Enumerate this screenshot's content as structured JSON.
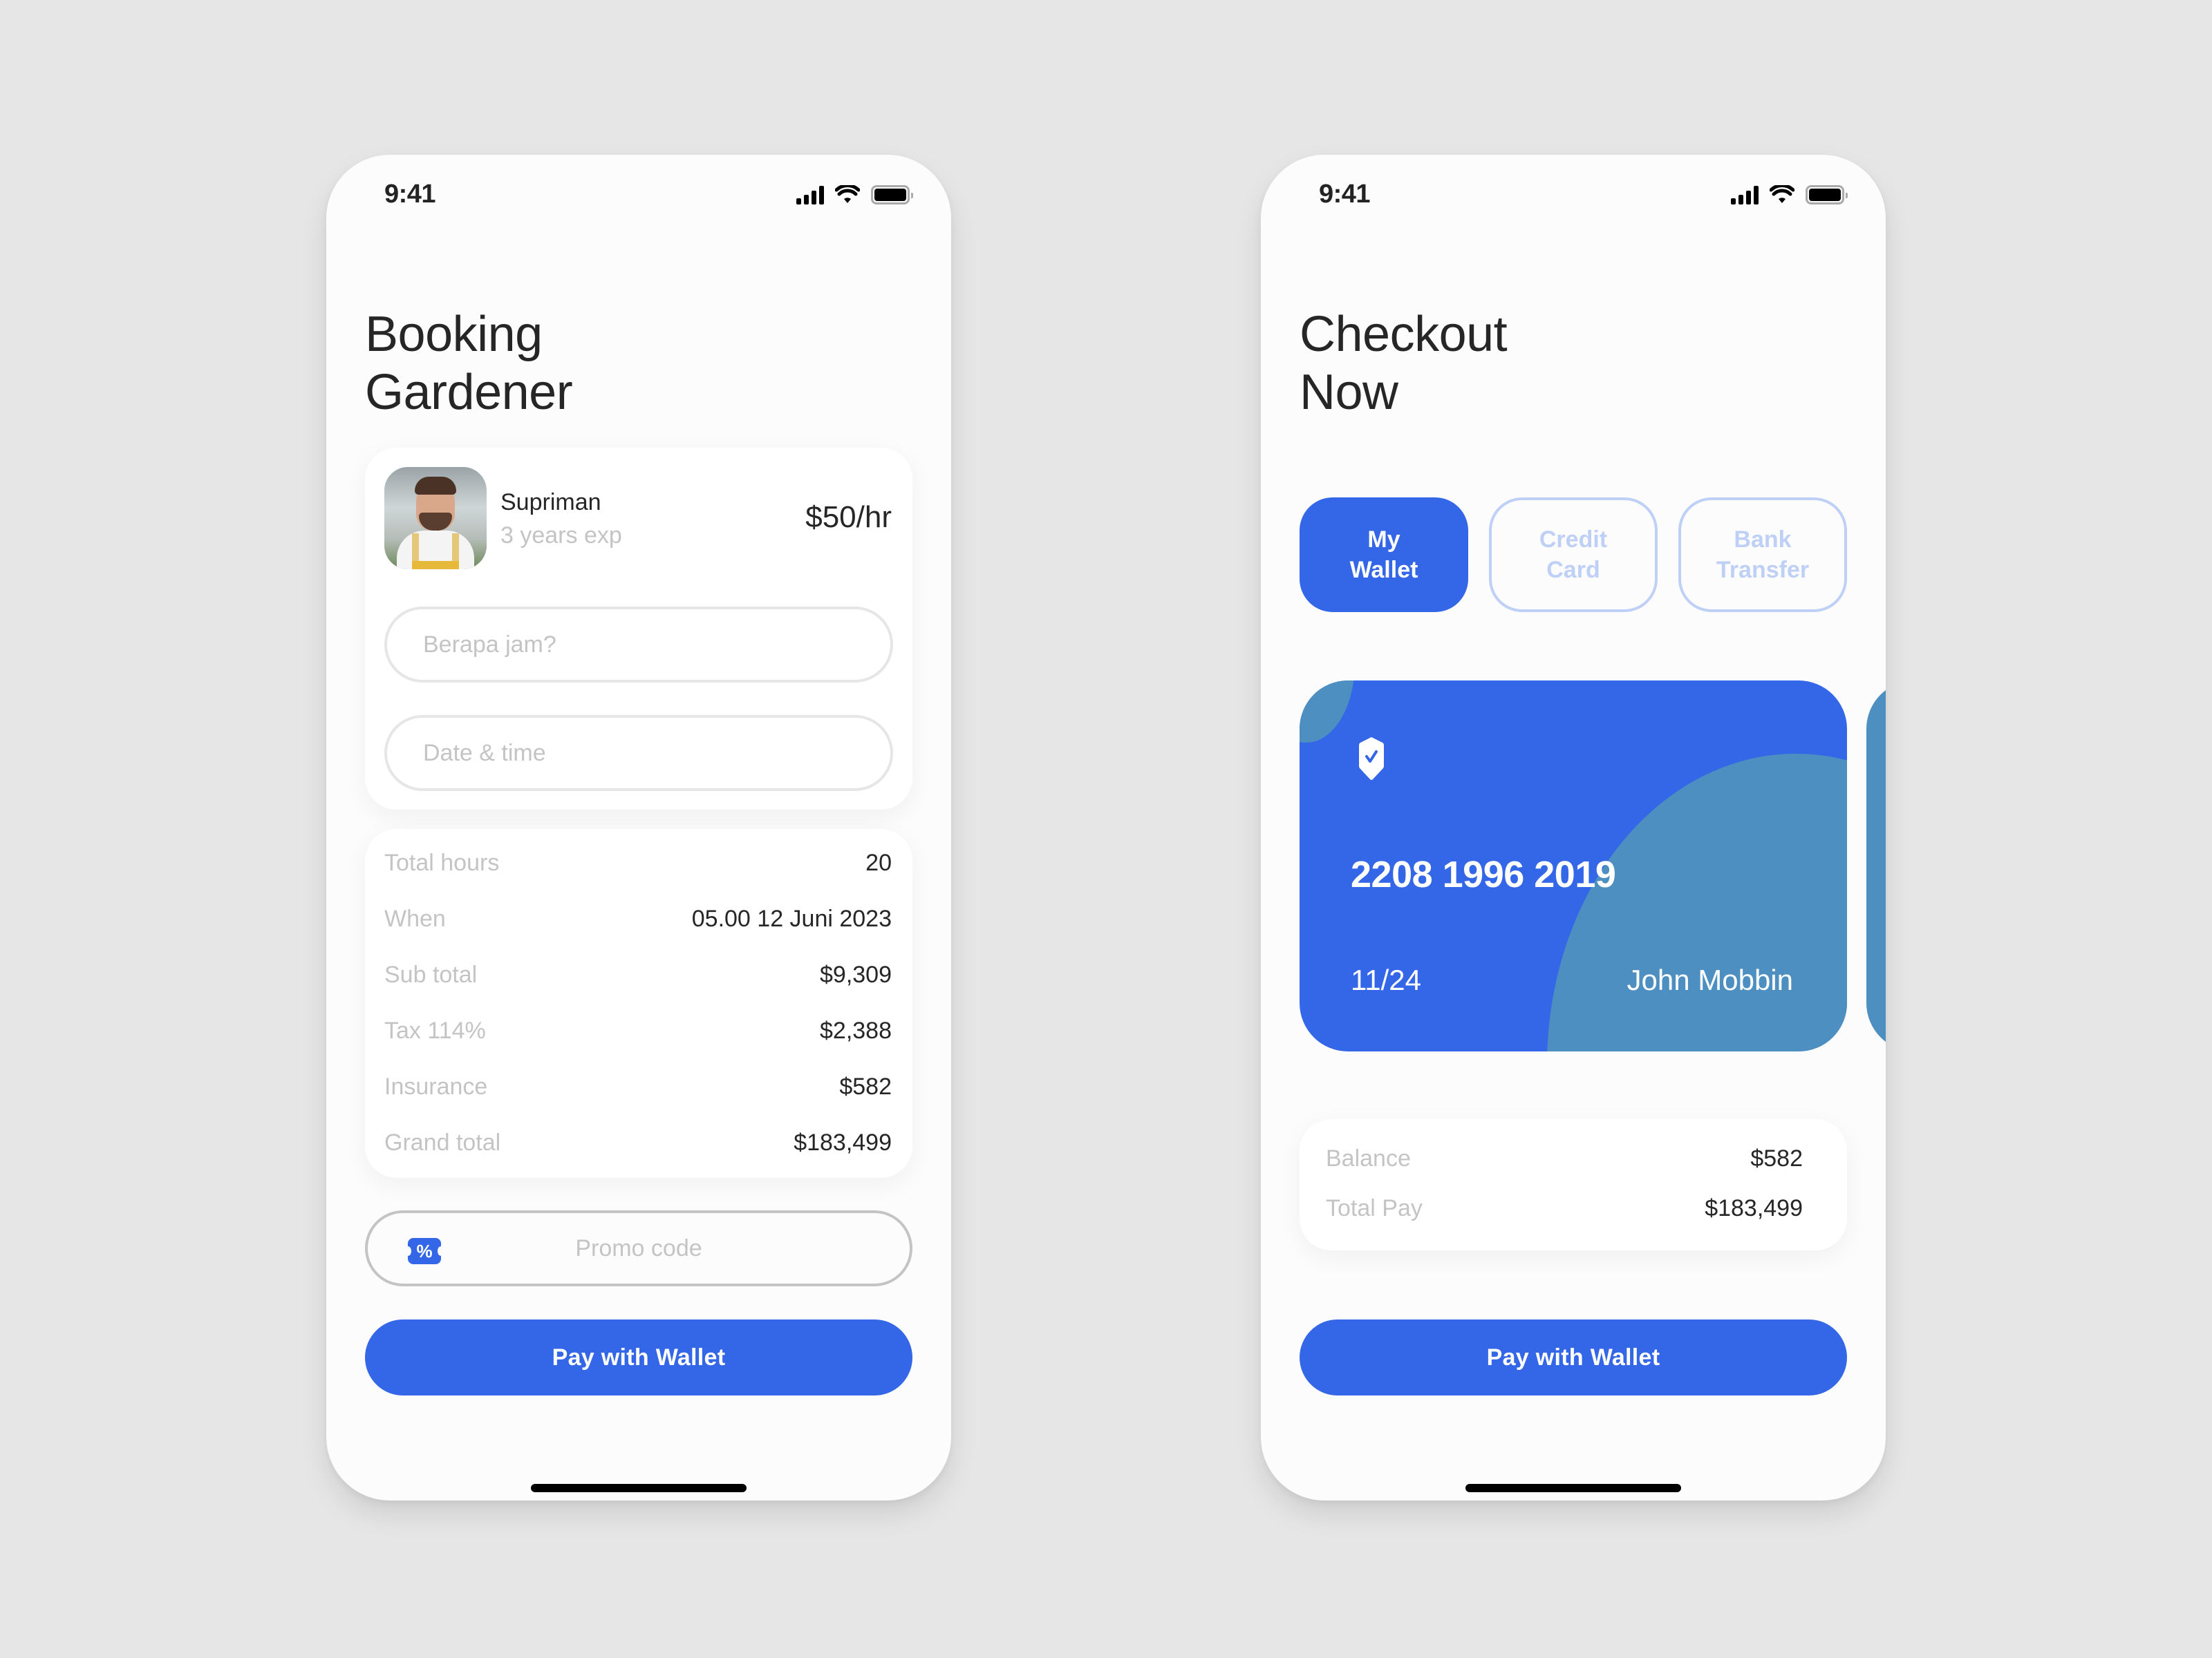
{
  "booking_screen": {
    "status_bar": {
      "time": "9:41",
      "icons": [
        "signal-icon",
        "wifi-icon",
        "battery-icon"
      ]
    },
    "title_line1": "Booking",
    "title_line2": "Gardener",
    "gardener": {
      "name": "Supriman",
      "experience": "3 years exp",
      "rate": "$50/hr",
      "avatar": "gardener-photo"
    },
    "hours_input": {
      "placeholder": "Berapa jam?",
      "value": ""
    },
    "datetime_input": {
      "placeholder": "Date & time",
      "value": ""
    },
    "summary": [
      {
        "label": "Total hours",
        "value": "20"
      },
      {
        "label": "When",
        "value": "05.00 12 Juni 2023"
      },
      {
        "label": "Sub total",
        "value": "$9,309"
      },
      {
        "label": "Tax 114%",
        "value": "$2,388"
      },
      {
        "label": "Insurance",
        "value": "$582"
      },
      {
        "label": "Grand total",
        "value": "$183,499"
      }
    ],
    "promo": {
      "icon": "discount-ticket-icon",
      "placeholder": "Promo code",
      "value": ""
    },
    "pay_button": "Pay with Wallet"
  },
  "checkout_screen": {
    "status_bar": {
      "time": "9:41",
      "icons": [
        "signal-icon",
        "wifi-icon",
        "battery-icon"
      ]
    },
    "title_line1": "Checkout",
    "title_line2": "Now",
    "payment_tabs": [
      {
        "line1": "My",
        "line2": "Wallet",
        "active": true
      },
      {
        "line1": "Credit",
        "line2": "Card",
        "active": false
      },
      {
        "line1": "Bank",
        "line2": "Transfer",
        "active": false
      }
    ],
    "wallet_card": {
      "icon": "shield-check-icon",
      "number": "2208 1996 2019",
      "expiry": "11/24",
      "holder": "John Mobbin"
    },
    "balance": [
      {
        "label": "Balance",
        "value": "$582"
      },
      {
        "label": "Total Pay",
        "value": "$183,499"
      }
    ],
    "pay_button": "Pay with Wallet"
  },
  "colors": {
    "accent": "#3467e8",
    "card_blob": "#4c8fc0",
    "tab_inactive": "#bfd0f7",
    "muted_text": "#c4c4c4",
    "text": "#262626",
    "background": "#e6e6e6",
    "screen": "#fcfcfc"
  }
}
